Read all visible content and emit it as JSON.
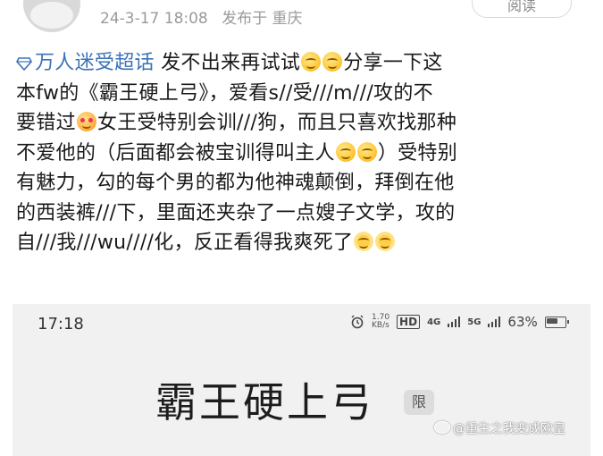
{
  "header": {
    "date": "24-3-17 18:08",
    "posted_from": "发布于 重庆",
    "read_button": "阅读"
  },
  "post": {
    "topic": "万人迷受超话",
    "lines": [
      [
        "发不出来再试试"
      ],
      [
        "本fw的《霸王硬上弓》，爱看s//受///m///攻的不"
      ],
      [
        "要错过"
      ],
      [
        "不爱他的（后面都会被宝训得叫主人"
      ],
      [
        "有魅力，勾的每个男的都为他神魂颠倒，拜倒在他"
      ],
      [
        "的西装裤///下，里面还夹杂了一点嫂子文学，攻的"
      ],
      [
        "自///我///wu////化，反正看得我爽死了"
      ]
    ],
    "line1_after_emoji": "分享一下这",
    "line3_after_emoji": "女王受特别会训///狗，而且只喜欢找那种",
    "line4_after_emoji": "）受特别",
    "emojis": [
      "grin-emoji",
      "love-eyes-emoji",
      "smile-emoji",
      "flower-smile-emoji"
    ]
  },
  "screenshot": {
    "time": "17:18",
    "net_speed_top": "1.70",
    "net_speed_unit": "KB/s",
    "hd_label": "HD",
    "net_4g": "4G",
    "net_5g": "5G",
    "battery": "63%",
    "book_title": "霸王硬上弓",
    "tag": "限"
  },
  "watermark": {
    "text": "@重生之我变成欧皇"
  },
  "colors": {
    "topic_blue": "#3b73b7",
    "meta_gray": "#9a9a9a",
    "screenshot_bg": "#f1f1f1"
  }
}
